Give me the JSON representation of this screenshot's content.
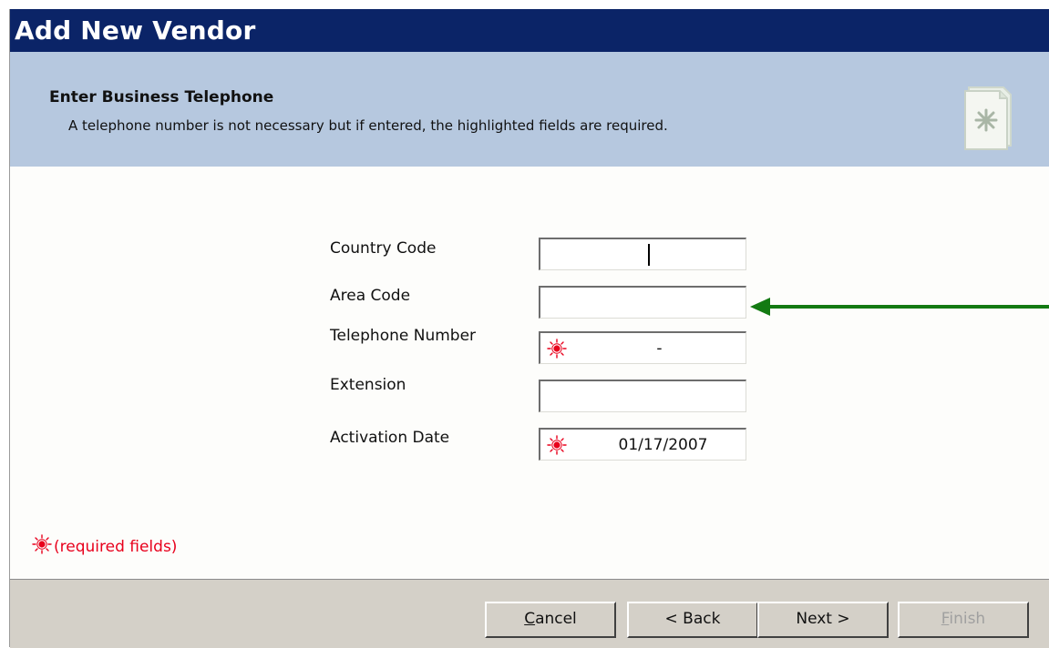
{
  "window": {
    "title": "Add New Vendor"
  },
  "header": {
    "title": "Enter Business Telephone",
    "subtitle": "A telephone number is not necessary but if entered, the highlighted fields are required."
  },
  "form": {
    "country_code": {
      "label": "Country Code",
      "value": "",
      "required": false
    },
    "area_code": {
      "label": "Area Code",
      "value": "",
      "required": false
    },
    "telephone_number": {
      "label": "Telephone Number",
      "value": "-",
      "required": true
    },
    "extension": {
      "label": "Extension",
      "value": "",
      "required": false
    },
    "activation_date": {
      "label": "Activation Date",
      "value": "01/17/2007",
      "required": true
    }
  },
  "required_legend": "(required fields)",
  "buttons": {
    "cancel": {
      "mnemonic": "C",
      "rest": "ancel"
    },
    "back": {
      "label": "< Back"
    },
    "next": {
      "label": "Next >"
    },
    "finish": {
      "mnemonic": "F",
      "rest": "inish",
      "disabled": true
    }
  },
  "colors": {
    "title_bar": "#0b2467",
    "header_band": "#b6c8df",
    "required_red": "#e8001c",
    "arrow_green": "#137a12"
  },
  "icons": {
    "required_marker": "required-asterisk-icon",
    "header_document": "document-icon",
    "pointer_arrow": "arrow-left-icon"
  }
}
